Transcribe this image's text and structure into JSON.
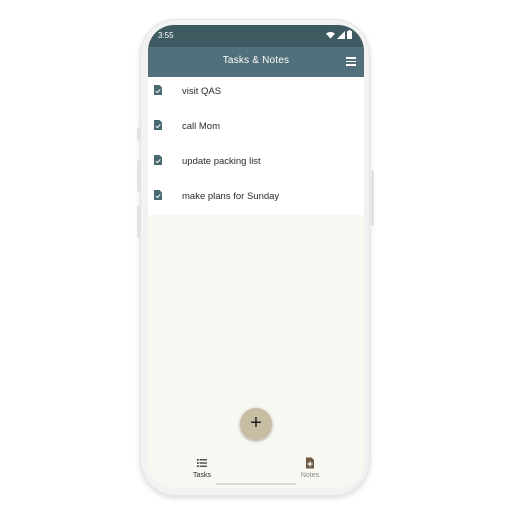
{
  "status_bar": {
    "time": "3:55",
    "icons": [
      "wifi-icon",
      "signal-icon",
      "battery-icon"
    ]
  },
  "app_bar": {
    "title": "Tasks & Notes",
    "menu_icon": "hamburger-menu-icon"
  },
  "tasks": {
    "item_icon": "note-document-icon",
    "items": [
      {
        "label": "visit QAS"
      },
      {
        "label": "call Mom"
      },
      {
        "label": "update packing list"
      },
      {
        "label": "make plans for Sunday"
      }
    ]
  },
  "fab": {
    "label": "+",
    "icon": "add-icon"
  },
  "bottom_nav": {
    "tabs": [
      {
        "label": "Tasks",
        "icon": "list-icon",
        "active": true
      },
      {
        "label": "Notes",
        "icon": "note-add-icon",
        "active": false
      }
    ]
  },
  "colors": {
    "status_bar": "#3e5a61",
    "app_bar": "#52707b",
    "screen_background": "#f8f7f2",
    "list_background": "#ffffff",
    "item_icon": "#4a6a72",
    "fab": "#c7bda2",
    "active_tab_text": "#2b2b2b",
    "inactive_tab_text": "#8a8a8a"
  }
}
